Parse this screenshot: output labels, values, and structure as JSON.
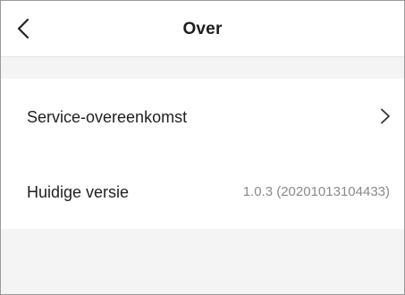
{
  "header": {
    "title": "Over",
    "back_icon": "chevron-left-icon"
  },
  "settings": {
    "items": [
      {
        "label": "Service-overeenkomst",
        "icon": "chevron-right-icon"
      },
      {
        "label": "Huidige versie",
        "value": "1.0.3 (20201013104433)"
      }
    ]
  },
  "colors": {
    "background": "#f4f4f4",
    "surface": "#ffffff",
    "text_primary": "#1f1f1f",
    "text_secondary": "#8a8a8a"
  }
}
